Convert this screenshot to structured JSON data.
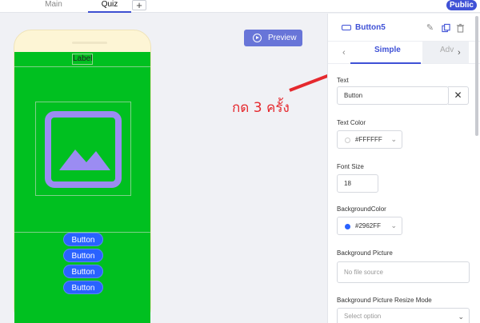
{
  "tabs": [
    {
      "label": "Main"
    },
    {
      "label": "Quiz"
    }
  ],
  "add_tab": "+",
  "public_label": "Public",
  "preview_label": "Preview",
  "annotation": "กด 3 ครั้ง",
  "phone": {
    "label_text": "Label",
    "buttons": [
      "Button",
      "Button",
      "Button",
      "Button"
    ]
  },
  "panel": {
    "component_name": "Button5",
    "tab_simple": "Simple",
    "tab_advanced": "Adv",
    "props": {
      "text_label": "Text",
      "text_value": "Button",
      "text_color_label": "Text Color",
      "text_color_value": "#FFFFFF",
      "font_size_label": "Font Size",
      "font_size_value": "18",
      "bg_color_label": "BackgroundColor",
      "bg_color_value": "#2962FF",
      "bg_picture_label": "Background Picture",
      "bg_picture_placeholder": "No file source",
      "resize_mode_label": "Background Picture Resize Mode",
      "resize_mode_placeholder": "Select option"
    }
  },
  "colors": {
    "accent": "#3f51d6",
    "screen_green": "#00c020",
    "button_blue": "#2962ff",
    "annotation_red": "#e5292e"
  }
}
